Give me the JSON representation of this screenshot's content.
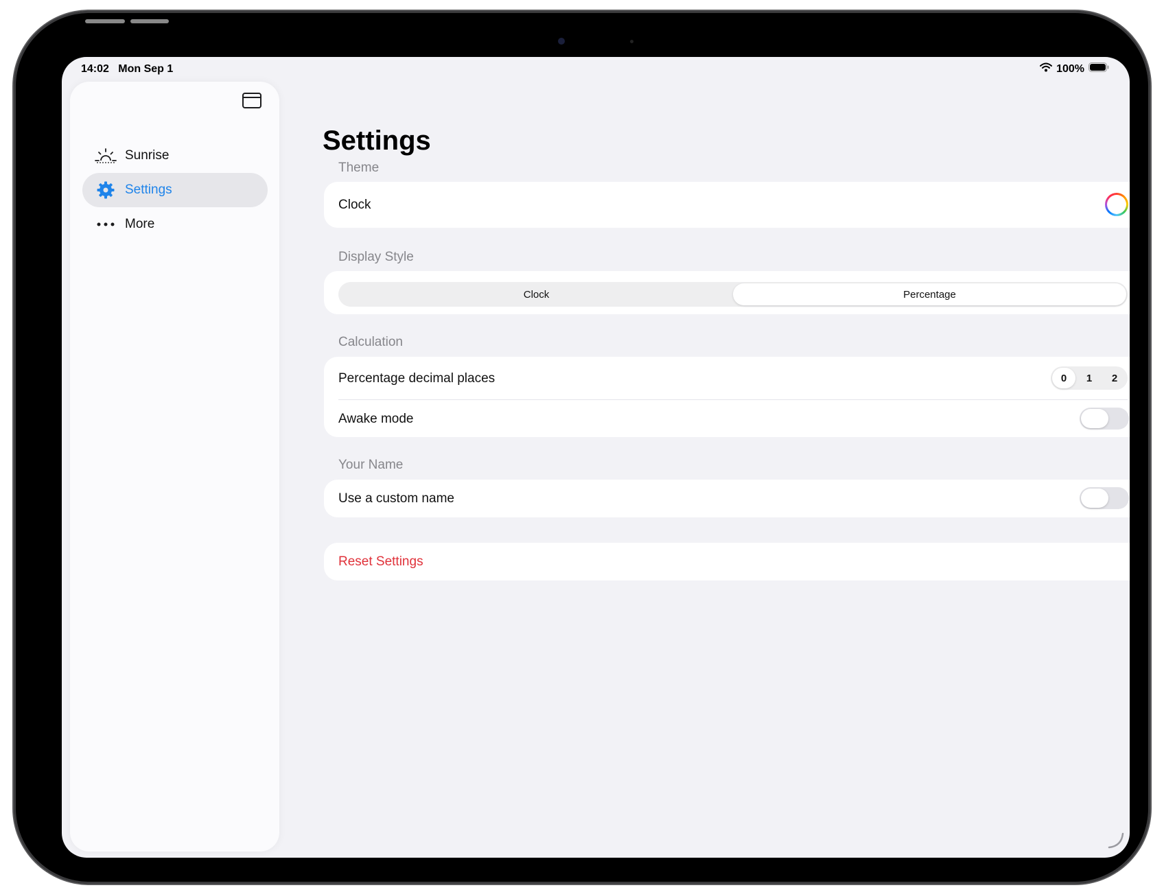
{
  "status_bar": {
    "time": "14:02",
    "date": "Mon Sep 1",
    "battery": "100%"
  },
  "sidebar": {
    "toggle_icon": "sidebar-icon",
    "items": [
      {
        "label": "Sunrise",
        "icon": "sunrise-icon",
        "selected": false
      },
      {
        "label": "Settings",
        "icon": "gear-icon",
        "selected": true
      },
      {
        "label": "More",
        "icon": "ellipsis-icon",
        "selected": false
      }
    ]
  },
  "page": {
    "title": "Settings"
  },
  "sections": {
    "theme": {
      "label": "Theme",
      "row_label": "Clock"
    },
    "display_style": {
      "label": "Display Style",
      "options": [
        "Clock",
        "Percentage"
      ],
      "selected": "Percentage"
    },
    "calculation": {
      "label": "Calculation",
      "decimal_label": "Percentage decimal places",
      "decimal_options": [
        "0",
        "1",
        "2"
      ],
      "decimal_selected": "0",
      "awake_label": "Awake mode",
      "awake_on": false
    },
    "your_name": {
      "label": "Your Name",
      "custom_label": "Use a custom name",
      "custom_on": false
    },
    "reset": {
      "label": "Reset Settings"
    }
  },
  "colors": {
    "accent": "#1f84ea",
    "destructive": "#e0323a",
    "background": "#f2f2f6"
  }
}
